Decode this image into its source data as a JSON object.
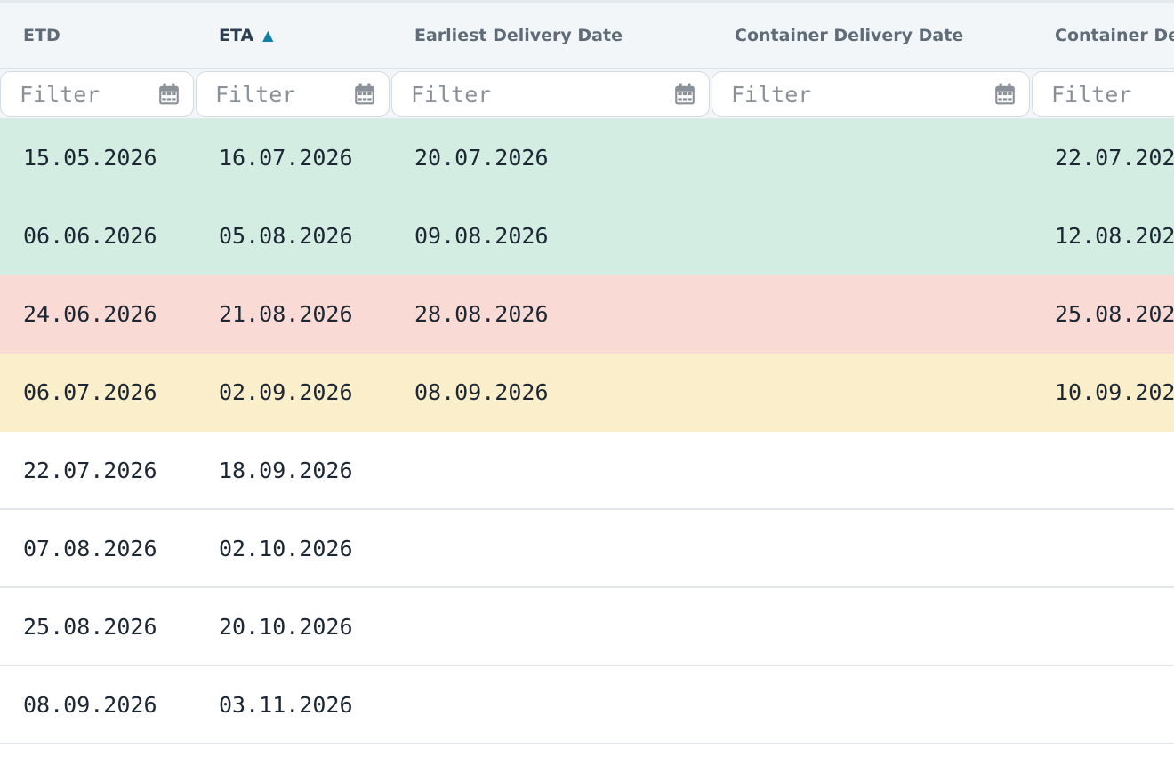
{
  "columns": [
    {
      "label": "ETD",
      "sorted": false
    },
    {
      "label": "ETA",
      "sorted": true,
      "sort_icon": "▲"
    },
    {
      "label": "Earliest Delivery Date",
      "sorted": false
    },
    {
      "label": "Container Delivery Date",
      "sorted": false
    },
    {
      "label": "Container De",
      "sorted": false
    }
  ],
  "filter_placeholder": "Filter",
  "rows": [
    {
      "status": "green",
      "cells": [
        "15.05.2026",
        "16.07.2026",
        "20.07.2026",
        "",
        "22.07.202"
      ]
    },
    {
      "status": "green",
      "cells": [
        "06.06.2026",
        "05.08.2026",
        "09.08.2026",
        "",
        "12.08.202"
      ]
    },
    {
      "status": "red",
      "cells": [
        "24.06.2026",
        "21.08.2026",
        "28.08.2026",
        "",
        "25.08.202"
      ]
    },
    {
      "status": "yellow",
      "cells": [
        "06.07.2026",
        "02.09.2026",
        "08.09.2026",
        "",
        "10.09.202"
      ]
    },
    {
      "status": "none",
      "cells": [
        "22.07.2026",
        "18.09.2026",
        "",
        "",
        ""
      ]
    },
    {
      "status": "none",
      "cells": [
        "07.08.2026",
        "02.10.2026",
        "",
        "",
        ""
      ]
    },
    {
      "status": "none",
      "cells": [
        "25.08.2026",
        "20.10.2026",
        "",
        "",
        ""
      ]
    },
    {
      "status": "none",
      "cells": [
        "08.09.2026",
        "03.11.2026",
        "",
        "",
        ""
      ]
    }
  ],
  "colors": {
    "row_green": "#d4ede2",
    "row_red": "#f9dad5",
    "row_yellow": "#fbeecb",
    "sort_accent": "#0e7fa6"
  },
  "icons": {
    "filter_calendar": "calendar-icon",
    "sort": "sort-ascending-icon"
  }
}
